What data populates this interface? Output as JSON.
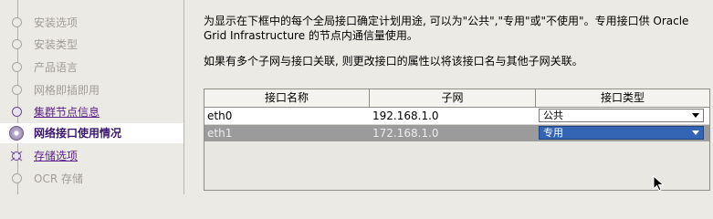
{
  "sidebar": {
    "steps": [
      {
        "label": "安装选项",
        "state": "done"
      },
      {
        "label": "安装类型",
        "state": "done"
      },
      {
        "label": "产品语言",
        "state": "done"
      },
      {
        "label": "网格即插即用",
        "state": "done"
      },
      {
        "label": "集群节点信息",
        "state": "link"
      },
      {
        "label": "网络接口使用情况",
        "state": "current"
      },
      {
        "label": "存储选项",
        "state": "next"
      },
      {
        "label": "OCR 存储",
        "state": "todo"
      }
    ]
  },
  "main": {
    "description1": "为显示在下框中的每个全局接口确定计划用途, 可以为\"公共\",\"专用\"或\"不使用\"。专用接口供 Oracle Grid Infrastructure 的节点内通信量使用。",
    "description2": "如果有多个子网与接口关联, 则更改接口的属性以将该接口名与其他子网关联。",
    "table": {
      "columns": [
        "接口名称",
        "子网",
        "接口类型"
      ],
      "rows": [
        {
          "name": "eth0",
          "subnet": "192.168.1.0",
          "type": "公共"
        },
        {
          "name": "eth1",
          "subnet": "172.168.1.0",
          "type": "专用"
        }
      ]
    }
  },
  "colors": {
    "accent": "#5a1f8c",
    "selection": "#3464b4"
  }
}
